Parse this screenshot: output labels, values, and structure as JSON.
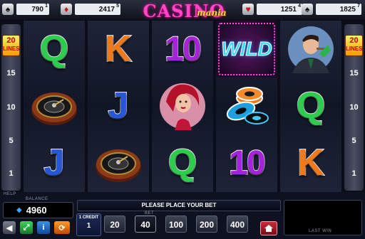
{
  "jackpots": [
    {
      "suit": "spade",
      "glyph": "♠",
      "color": "#111111",
      "value": "790",
      "level": "1"
    },
    {
      "suit": "diamond",
      "glyph": "♦",
      "color": "#d0101c",
      "value": "2417",
      "level": "5"
    },
    {
      "suit": "heart",
      "glyph": "♥",
      "color": "#d0101c",
      "value": "1251",
      "level": "4"
    },
    {
      "suit": "spade",
      "glyph": "♠",
      "color": "#111111",
      "value": "1825",
      "level": "7"
    }
  ],
  "logo": {
    "main": "CASINO",
    "sub": "mania"
  },
  "lines": {
    "count": "20",
    "word": "LINES",
    "markers": [
      "15",
      "10",
      "5",
      "1"
    ]
  },
  "reels": [
    [
      {
        "sym": "Q",
        "color": "green"
      },
      {
        "sym": "roulette"
      },
      {
        "sym": "J",
        "color": "blue"
      }
    ],
    [
      {
        "sym": "K",
        "color": "orange"
      },
      {
        "sym": "J",
        "color": "blue"
      },
      {
        "sym": "roulette"
      }
    ],
    [
      {
        "sym": "10",
        "color": "purple"
      },
      {
        "sym": "woman"
      },
      {
        "sym": "Q",
        "color": "green"
      }
    ],
    [
      {
        "sym": "WILD"
      },
      {
        "sym": "chips"
      },
      {
        "sym": "10",
        "color": "purple"
      }
    ],
    [
      {
        "sym": "man"
      },
      {
        "sym": "Q",
        "color": "green"
      },
      {
        "sym": "K",
        "color": "orange"
      }
    ]
  ],
  "bottom": {
    "help_label": "HELP",
    "balance_label": "BALANCE",
    "balance": "4960",
    "message": "PLEASE PLACE YOUR BET",
    "credit_label": "1 CREDIT",
    "credit_value": "1",
    "bet_label": "BET",
    "bets": [
      "20",
      "40",
      "100",
      "200",
      "400"
    ],
    "selected_bet": "40",
    "last_win_label": "LAST WIN",
    "last_win": ""
  },
  "colors": {
    "accent_green": "#2ecc4c",
    "accent_blue": "#3fa6ff",
    "home_red": "#c72a36"
  }
}
